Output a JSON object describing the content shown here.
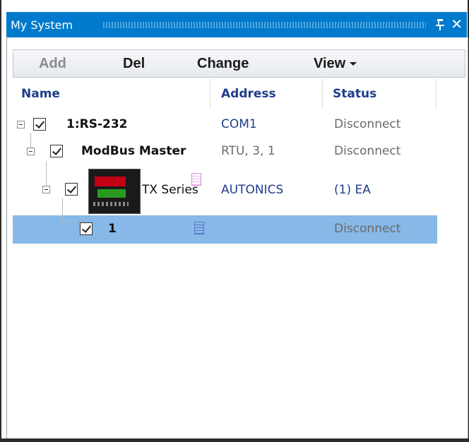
{
  "window": {
    "title": "My System"
  },
  "toolbar": {
    "add_label": "Add",
    "del_label": "Del",
    "change_label": "Change",
    "view_label": "View"
  },
  "columns": {
    "name": "Name",
    "address": "Address",
    "status": "Status"
  },
  "tree": {
    "port": {
      "name": "1:RS-232",
      "address": "COM1",
      "status": "Disconnect"
    },
    "master": {
      "name": "ModBus Master",
      "address": "RTU, 3, 1",
      "status": "Disconnect"
    },
    "device": {
      "name": "TX Series",
      "address": "AUTONICS",
      "status": "(1) EA"
    },
    "unit": {
      "name": "1",
      "address": "",
      "status": "Disconnect"
    }
  },
  "colors": {
    "title_bar": "#007acc",
    "selection": "#86b8e8",
    "header_text": "#1f3d8a"
  }
}
